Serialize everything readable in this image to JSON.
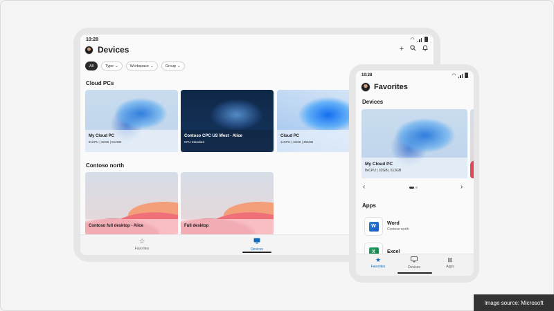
{
  "tablet": {
    "status_time": "10:28",
    "title": "Devices",
    "actions": {
      "add_icon": "+",
      "search_icon": "⌕",
      "bell_icon": "🔔"
    },
    "filters": [
      {
        "label": "All",
        "active": true
      },
      {
        "label": "Type",
        "active": false
      },
      {
        "label": "Workspace",
        "active": false
      },
      {
        "label": "Group",
        "active": false
      }
    ],
    "sections": [
      {
        "title": "Cloud PCs",
        "cards": [
          {
            "name": "My Cloud PC",
            "spec": "8vCPU | 32GB | 512GB",
            "theme": "light"
          },
          {
            "name": "Contoso CPC US West - Alice",
            "spec": "CPU Standard",
            "theme": "dark"
          },
          {
            "name": "Cloud PC",
            "spec": "4vCPU | 16GB | 256GB",
            "theme": "light"
          }
        ]
      },
      {
        "title": "Contoso north",
        "cards": [
          {
            "name": "Contoso full desktop - Alice",
            "spec": "",
            "theme": "light"
          },
          {
            "name": "Full desktop",
            "spec": "",
            "theme": "light"
          }
        ]
      }
    ],
    "nav": [
      {
        "label": "Favorites",
        "icon": "☆",
        "active": false
      },
      {
        "label": "Devices",
        "icon": "▭",
        "active": true
      }
    ]
  },
  "phone": {
    "status_time": "10:28",
    "title": "Favorites",
    "devices_title": "Devices",
    "device_card": {
      "name": "My Cloud PC",
      "spec": "8vCPU | 32GB | 512GB"
    },
    "prev_icon": "‹",
    "next_icon": "›",
    "apps_title": "Apps",
    "apps": [
      {
        "name": "Word",
        "subtitle": "Contoso north",
        "logo_letter": "W"
      },
      {
        "name": "Excel",
        "subtitle": "",
        "logo_letter": "X"
      }
    ],
    "nav": [
      {
        "label": "Favorites",
        "icon": "★",
        "active": true
      },
      {
        "label": "Devices",
        "icon": "▭",
        "active": false
      },
      {
        "label": "Apps",
        "icon": "⊞",
        "active": false
      }
    ]
  },
  "credit": "Image source: Microsoft",
  "colors": {
    "accent": "#0f6cbd",
    "background": "#f5f5f5"
  }
}
